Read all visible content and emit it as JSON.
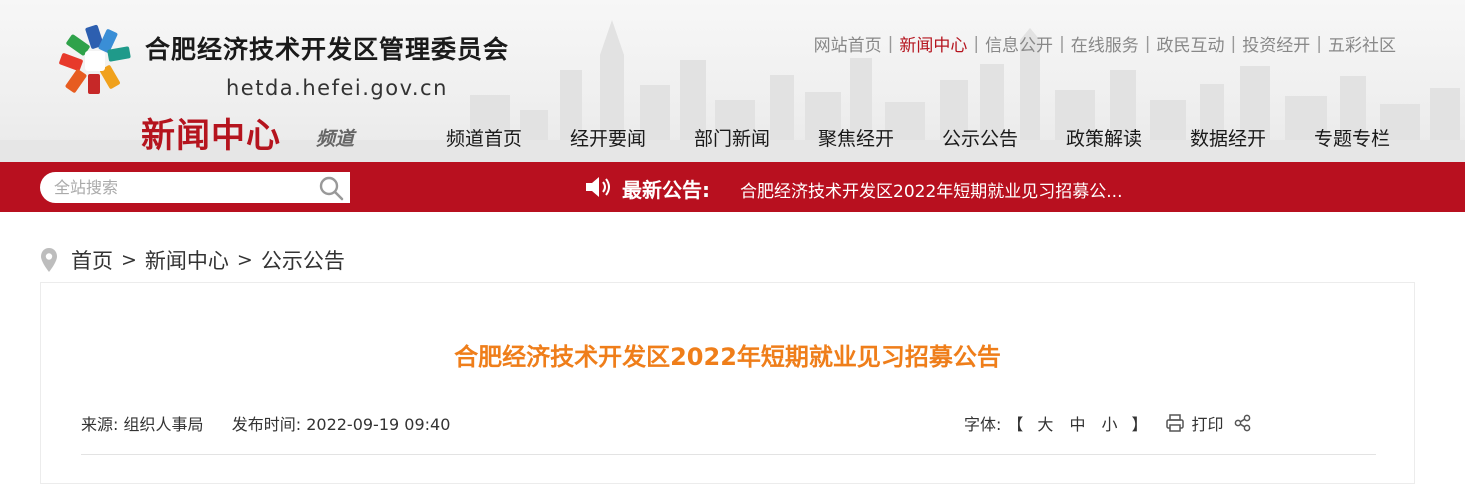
{
  "header": {
    "site_title": "合肥经济技术开发区管理委员会",
    "site_domain": "hetda.hefei.gov.cn",
    "channel_name": "新闻中心",
    "channel_suffix": "频道",
    "top_links": [
      "网站首页",
      "新闻中心",
      "信息公开",
      "在线服务",
      "政民互动",
      "投资经开",
      "五彩社区"
    ],
    "top_links_active": "新闻中心",
    "top_link_separator": "|",
    "nav": [
      "频道首页",
      "经开要闻",
      "部门新闻",
      "聚焦经开",
      "公示公告",
      "政策解读",
      "数据经开",
      "专题专栏"
    ]
  },
  "search": {
    "placeholder": "全站搜索",
    "icon": "search-icon"
  },
  "notice": {
    "icon": "speaker-icon",
    "label": "最新公告:",
    "text": "合肥经济技术开发区2022年短期就业见习招募公..."
  },
  "breadcrumb": {
    "icon": "location-pin-icon",
    "items": [
      "首页",
      "新闻中心",
      "公示公告"
    ],
    "separator": ">"
  },
  "article": {
    "title": "合肥经济技术开发区2022年短期就业见习招募公告",
    "source_label": "来源:",
    "source": "组织人事局",
    "time_label": "发布时间:",
    "time": "2022-09-19 09:40",
    "font_label": "字体:",
    "bracket_open": "【",
    "font_sizes": [
      "大",
      "中",
      "小"
    ],
    "bracket_close": "】",
    "print_label": "打印"
  },
  "colors": {
    "brand_red": "#b8101f",
    "channel_red": "#b5141e",
    "title_orange": "#ef7e1a",
    "active_link": "#b5141e"
  }
}
